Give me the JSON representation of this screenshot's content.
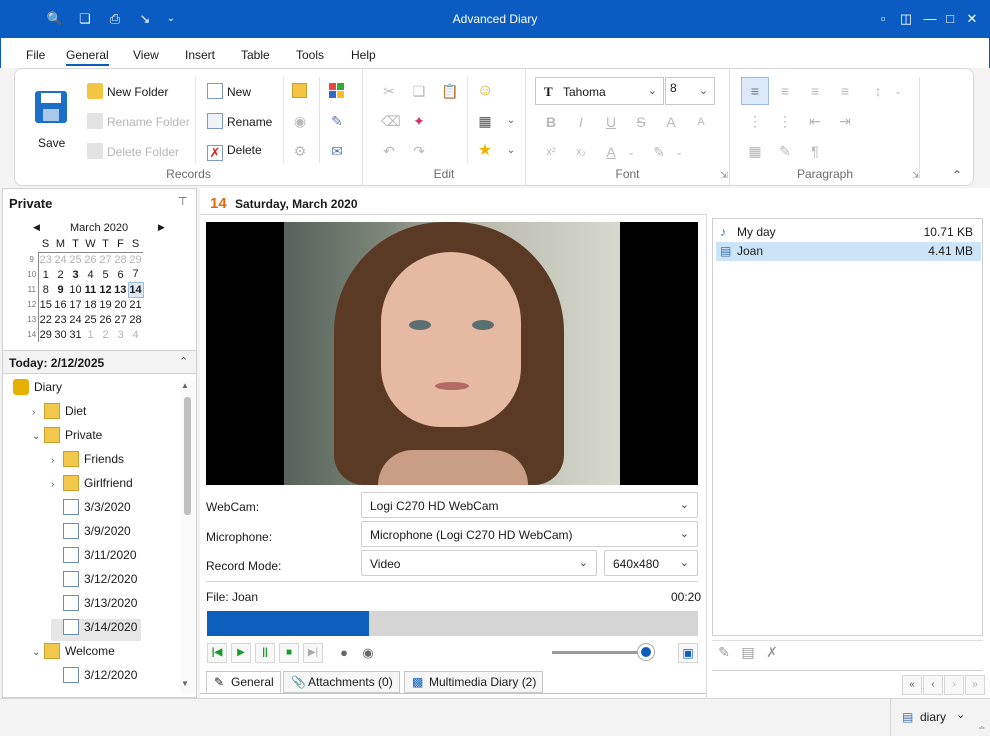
{
  "app": {
    "title": "Advanced Diary"
  },
  "menu": [
    "File",
    "General",
    "View",
    "Insert",
    "Table",
    "Tools",
    "Help"
  ],
  "menu_active": "General",
  "ribbon": {
    "save_label": "Save",
    "new_folder": "New Folder",
    "rename_folder": "Rename Folder",
    "delete_folder": "Delete Folder",
    "new": "New",
    "rename": "Rename",
    "delete": "Delete",
    "groups": {
      "records": "Records",
      "edit": "Edit",
      "font": "Font",
      "paragraph": "Paragraph"
    },
    "font_name": "Tahoma",
    "font_size": "8"
  },
  "left": {
    "header": "Private",
    "calendar": {
      "month": "March 2020",
      "weekdays": [
        "S",
        "M",
        "T",
        "W",
        "T",
        "F",
        "S"
      ],
      "weeks": [
        {
          "wk": "9",
          "days": [
            "23",
            "24",
            "25",
            "26",
            "27",
            "28",
            "29"
          ]
        },
        {
          "wk": "10",
          "days": [
            "1",
            "2",
            "3",
            "4",
            "5",
            "6",
            "7"
          ]
        },
        {
          "wk": "11",
          "days": [
            "8",
            "9",
            "10",
            "11",
            "12",
            "13",
            "14"
          ]
        },
        {
          "wk": "12",
          "days": [
            "15",
            "16",
            "17",
            "18",
            "19",
            "20",
            "21"
          ]
        },
        {
          "wk": "13",
          "days": [
            "22",
            "23",
            "24",
            "25",
            "26",
            "27",
            "28"
          ]
        },
        {
          "wk": "14",
          "days": [
            "29",
            "30",
            "31",
            "1",
            "2",
            "3",
            "4"
          ]
        }
      ]
    },
    "today_label": "Today: 2/12/2025",
    "tree": [
      {
        "label": "Diary",
        "level": 0
      },
      {
        "label": "Diet",
        "level": 1
      },
      {
        "label": "Private",
        "level": 1
      },
      {
        "label": "Friends",
        "level": 2
      },
      {
        "label": "Girlfriend",
        "level": 2
      },
      {
        "label": "3/3/2020",
        "level": 2
      },
      {
        "label": "3/9/2020",
        "level": 2
      },
      {
        "label": "3/11/2020",
        "level": 2
      },
      {
        "label": "3/12/2020",
        "level": 2
      },
      {
        "label": "3/13/2020",
        "level": 2
      },
      {
        "label": "3/14/2020",
        "level": 2
      },
      {
        "label": "Welcome",
        "level": 1
      },
      {
        "label": "3/12/2020",
        "level": 2
      }
    ]
  },
  "entry": {
    "day": "14",
    "date": "Saturday, March 2020"
  },
  "capture": {
    "webcam_label": "WebCam:",
    "webcam_value": "Logi C270 HD WebCam",
    "mic_label": "Microphone:",
    "mic_value": "Microphone (Logi C270 HD WebCam)",
    "mode_label": "Record Mode:",
    "mode_value": "Video",
    "resolution": "640x480",
    "file_label": "File: Joan",
    "time": "00:20",
    "progress": 0.33,
    "volume": 1.0
  },
  "tabs": [
    "General",
    "Attachments (0)",
    "Multimedia Diary (2)"
  ],
  "files": [
    {
      "name": "My day",
      "size": "10.71 KB"
    },
    {
      "name": "Joan",
      "size": "4.41 MB"
    }
  ],
  "status": {
    "db": "diary"
  }
}
